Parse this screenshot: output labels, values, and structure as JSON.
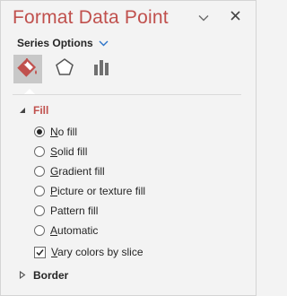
{
  "pane": {
    "title": "Format Data Point",
    "options_label": "Series Options"
  },
  "tabs": [
    {
      "name": "Fill & Line",
      "icon": "paint-bucket-icon",
      "active": true
    },
    {
      "name": "Effects",
      "icon": "pentagon-icon",
      "active": false
    },
    {
      "name": "Series Options",
      "icon": "bar-chart-icon",
      "active": false
    }
  ],
  "fill": {
    "heading": "Fill",
    "expanded": true,
    "options": [
      {
        "label": "No fill",
        "checked": true
      },
      {
        "label": "Solid fill",
        "checked": false
      },
      {
        "label": "Gradient fill",
        "checked": false
      },
      {
        "label": "Picture or texture fill",
        "checked": false
      },
      {
        "label": "Pattern fill",
        "checked": false
      },
      {
        "label": "Automatic",
        "checked": false
      }
    ],
    "vary_colors": {
      "label": "Vary colors by slice",
      "checked": true
    }
  },
  "border": {
    "heading": "Border",
    "expanded": false
  },
  "colors": {
    "accent": "#c0504d",
    "background": "#f3f3f3",
    "active_tab": "#c8c8c8"
  }
}
